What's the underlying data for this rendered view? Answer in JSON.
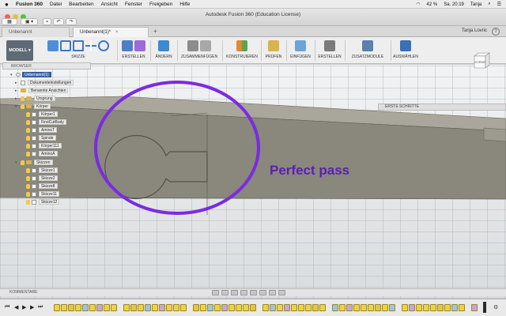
{
  "menubar": {
    "apple": "",
    "items": [
      "Fusion 360",
      "Datei",
      "Bearbeiten",
      "Ansicht",
      "Fenster",
      "Freigeben",
      "Hilfe"
    ],
    "battery": "42 %",
    "clock": "Sa. 20:19",
    "user": "Tanja"
  },
  "window": {
    "title": "Autodesk Fusion 360 (Education License)",
    "user_label": "Tanja Lovric",
    "help_label": "?"
  },
  "tabs": [
    {
      "label": "Unbenannt"
    },
    {
      "label": "Unbenannt(1)*",
      "close": "×"
    }
  ],
  "ribbon": {
    "mode_label": "MODELL",
    "groups": [
      {
        "label": "SKIZZE"
      },
      {
        "label": "ERSTELLEN"
      },
      {
        "label": "ÄNDERN"
      },
      {
        "label": "ZUSAMMENFÜGEN"
      },
      {
        "label": "KONSTRUIEREN"
      },
      {
        "label": "PRÜFEN"
      },
      {
        "label": "EINFÜGEN"
      },
      {
        "label": "ERSTELLEN"
      },
      {
        "label": "ZUSATZMODULE"
      },
      {
        "label": "AUSWÄHLEN"
      }
    ]
  },
  "browser": {
    "title": "BROWSER",
    "rows": [
      {
        "label": "Unbenannt(1)"
      },
      {
        "label": "Dokumenteinstellungen"
      },
      {
        "label": "Benannte Ansichten"
      },
      {
        "label": "Ursprung"
      },
      {
        "label": "Körper"
      },
      {
        "label": "Körper1"
      },
      {
        "label": "FirstCutBody"
      },
      {
        "label": "AminoT"
      },
      {
        "label": "Spirale"
      },
      {
        "label": "Körper111"
      },
      {
        "label": "AminoA"
      },
      {
        "label": "Skizzen"
      },
      {
        "label": "Skizze1"
      },
      {
        "label": "Skizze2"
      },
      {
        "label": "Skizze8"
      },
      {
        "label": "Skizze11"
      },
      {
        "label": "Skizze12"
      }
    ]
  },
  "getting_started": "ERSTE SCHRITTE",
  "viewcube_label": "VORNE",
  "annotation": "Perfect pass",
  "comments_label": "KOMMENTARE",
  "timeline": {
    "controls": [
      "⏮",
      "◀",
      "▶",
      "▶",
      "⏭"
    ]
  },
  "colors": {
    "annotation": "#5a1fb4",
    "circle": "#7a2be2",
    "body": "#8a877c",
    "root_highlight": "#3e66a8"
  }
}
